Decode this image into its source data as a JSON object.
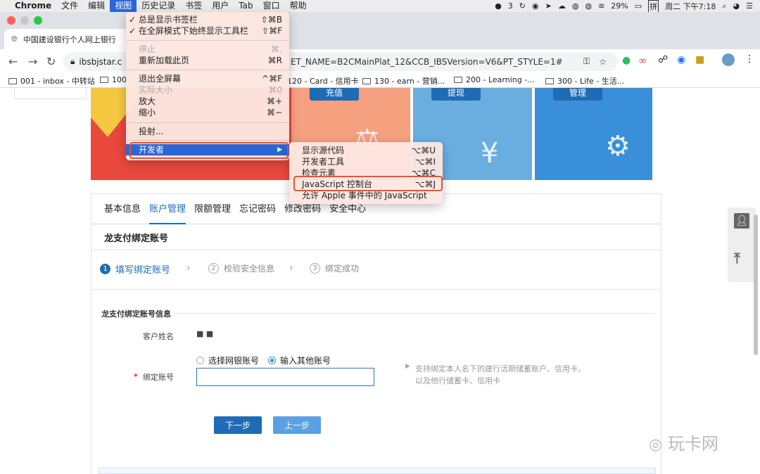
{
  "menubar": {
    "apple": "",
    "app": "Chrome",
    "items": [
      "文件",
      "编辑",
      "视图",
      "历史记录",
      "书签",
      "用户",
      "Tab",
      "窗口",
      "帮助"
    ],
    "right": {
      "badge": "3",
      "battery": "29%",
      "ime": "拼",
      "datetime": "周二 下午7:18"
    }
  },
  "browser": {
    "tab_title": "中国建设银行个人网上银行",
    "url_head": "ibsbjstar.c",
    "url_tail": "ET_NAME=B2CMainPlat_12&CCB_IBSVersion=V6&PT_STYLE=1#",
    "bookmarks": [
      "001 - inbox - 中转站",
      "100",
      "120 - Card - 信用卡",
      "130 - earn - 营销...",
      "200 - Learning -...",
      "300 - Life - 生活..."
    ]
  },
  "banner": {
    "tiles": [
      {
        "label": "充值",
        "color": "#f5a07f",
        "icon": "scale-icon"
      },
      {
        "label": "提现",
        "color": "#6aaee0",
        "icon": "yuan-bag-icon"
      },
      {
        "label": "管理",
        "color": "#3a8fd9",
        "icon": "yuan-gear-icon"
      }
    ]
  },
  "tabs": [
    "基本信息",
    "账户管理",
    "限额管理",
    "忘记密码",
    "修改密码",
    "安全中心"
  ],
  "section_title": "龙支付绑定账号",
  "steps": [
    {
      "num": "1",
      "label": "填写绑定账号"
    },
    {
      "num": "2",
      "label": "校验安全信息"
    },
    {
      "num": "3",
      "label": "绑定成功"
    }
  ],
  "form": {
    "group_title": "龙支付绑定账号信息",
    "name_label": "客户姓名",
    "name_value": "■ ■",
    "radio_1": "选择网银账号",
    "radio_2": "输入其他账号",
    "required_mark": "*",
    "account_label": "绑定账号",
    "hint": "支持绑定本人名下的建行活期储蓄账户、信用卡，以及他行储蓄卡、信用卡",
    "next_btn": "下一步",
    "prev_btn": "上一步"
  },
  "watermark": "玩卡网",
  "view_menu": {
    "items": [
      {
        "label": "✓ 总是显示书签栏",
        "shortcut": "⇧⌘B",
        "disabled": false
      },
      {
        "label": "✓ 在全屏模式下始终显示工具栏",
        "shortcut": "⇧⌘F",
        "disabled": false
      },
      {
        "label": "停止",
        "shortcut": "⌘.",
        "disabled": true
      },
      {
        "label": "重新加载此页",
        "shortcut": "⌘R",
        "disabled": false
      },
      {
        "label": "退出全屏幕",
        "shortcut": "^⌘F",
        "disabled": false
      },
      {
        "label": "实际大小",
        "shortcut": "⌘0",
        "disabled": true
      },
      {
        "label": "放大",
        "shortcut": "⌘+",
        "disabled": false
      },
      {
        "label": "缩小",
        "shortcut": "⌘−",
        "disabled": false
      },
      {
        "label": "投射...",
        "shortcut": "",
        "disabled": false
      },
      {
        "label": "开发者",
        "shortcut": "▶",
        "disabled": false
      }
    ]
  },
  "dev_menu": {
    "items": [
      {
        "label": "显示源代码",
        "shortcut": "⌥⌘U"
      },
      {
        "label": "开发者工具",
        "shortcut": "⌥⌘I"
      },
      {
        "label": "检查元素",
        "shortcut": "⌥⌘C"
      },
      {
        "label": "JavaScript 控制台",
        "shortcut": "⌥⌘J"
      },
      {
        "label": "允许 Apple 事件中的 JavaScript",
        "shortcut": ""
      }
    ]
  },
  "colors": {
    "accent": "#1f6bb5",
    "highlight": "#e8532f",
    "menu_hl": "#2b66d9"
  }
}
